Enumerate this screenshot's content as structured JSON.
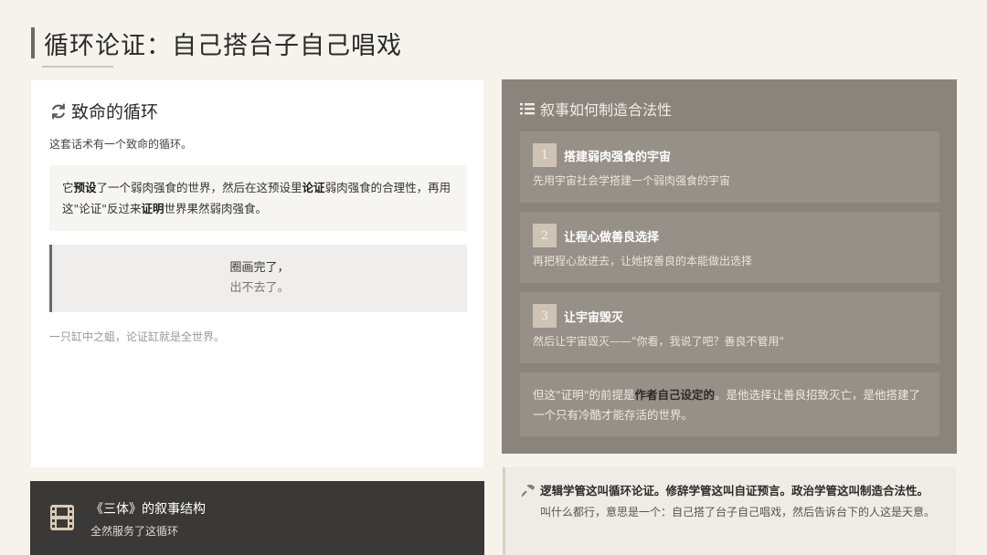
{
  "page": {
    "title": "循环论证：自己搭台子自己唱戏"
  },
  "left_card": {
    "heading": "致命的循环",
    "intro": "这套话术有一个致命的循环。",
    "quote": {
      "p1": "它",
      "b1": "预设",
      "p2": "了一个弱肉强食的世界，然后在这预设里",
      "b2": "论证",
      "p3": "弱肉强食的合理性，再用这\"论证\"反过来",
      "b3": "证明",
      "p4": "世界果然弱肉强食。"
    },
    "circle": {
      "line1": "圈画完了，",
      "line2": "出不去了。"
    },
    "note": "一只缸中之蛆，论证缸就是全世界。"
  },
  "right_card": {
    "heading": "叙事如何制造合法性",
    "steps": [
      {
        "num": "1",
        "title": "搭建弱肉强食的宇宙",
        "desc": "先用宇宙社会学搭建一个弱肉强食的宇宙"
      },
      {
        "num": "2",
        "title": "让程心做善良选择",
        "desc": "再把程心放进去，让她按善良的本能做出选择"
      },
      {
        "num": "3",
        "title": "让宇宙毁灭",
        "desc": "然后让宇宙毁灭——\"你看，我说了吧？善良不管用\""
      }
    ],
    "conclusion": {
      "p1": "但这\"证明\"的前提是",
      "hl": "作者自己设定的",
      "p2": "。是他选择让善良招致灭亡，是他搭建了一个只有冷酷才能存活的世界。"
    }
  },
  "dark_card": {
    "title": "《三体》的叙事结构",
    "subtitle": "全然服务了这循环"
  },
  "tip_card": {
    "line1": "逻辑学管这叫循环论证。修辞学管这叫自证预言。政治学管这叫制造合法性。",
    "line2": "叫什么都行，意思是一个：自己搭了台子自己唱戏，然后告诉台下的人这是天意。"
  },
  "icons": {
    "left": "refresh-icon",
    "right": "list-icon",
    "dark": "film-icon",
    "tip": "hammer-icon"
  },
  "colors": {
    "background": "#f6f3ec",
    "right_panel": "#8a847c",
    "dark_panel": "#3a3938",
    "accent": "#cfc4b3"
  }
}
